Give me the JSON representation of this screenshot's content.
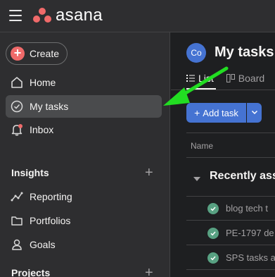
{
  "topbar": {
    "logo_text": "asana",
    "brand_color": "#f06a6a"
  },
  "sidebar": {
    "create_label": "Create",
    "nav": [
      {
        "label": "Home",
        "icon": "home-icon"
      },
      {
        "label": "My tasks",
        "icon": "check-circle-icon",
        "active": true
      },
      {
        "label": "Inbox",
        "icon": "bell-icon"
      }
    ],
    "insights": {
      "title": "Insights",
      "items": [
        {
          "label": "Reporting",
          "icon": "chart-icon"
        },
        {
          "label": "Portfolios",
          "icon": "folder-icon"
        },
        {
          "label": "Goals",
          "icon": "person-icon"
        }
      ]
    },
    "projects": {
      "title": "Projects"
    }
  },
  "main": {
    "avatar_initials": "Co",
    "title": "My tasks",
    "tabs": [
      {
        "label": "List",
        "active": true
      },
      {
        "label": "Board",
        "active": false
      }
    ],
    "add_task_label": "Add task",
    "column_name": "Name",
    "group_title": "Recently assigned",
    "tasks": [
      {
        "name": "blog tech t"
      },
      {
        "name": "PE-1797 de"
      },
      {
        "name": "SPS tasks a"
      }
    ]
  },
  "colors": {
    "accent": "#4573d2",
    "complete": "#58a182",
    "annotation_arrow": "#22dd22"
  }
}
